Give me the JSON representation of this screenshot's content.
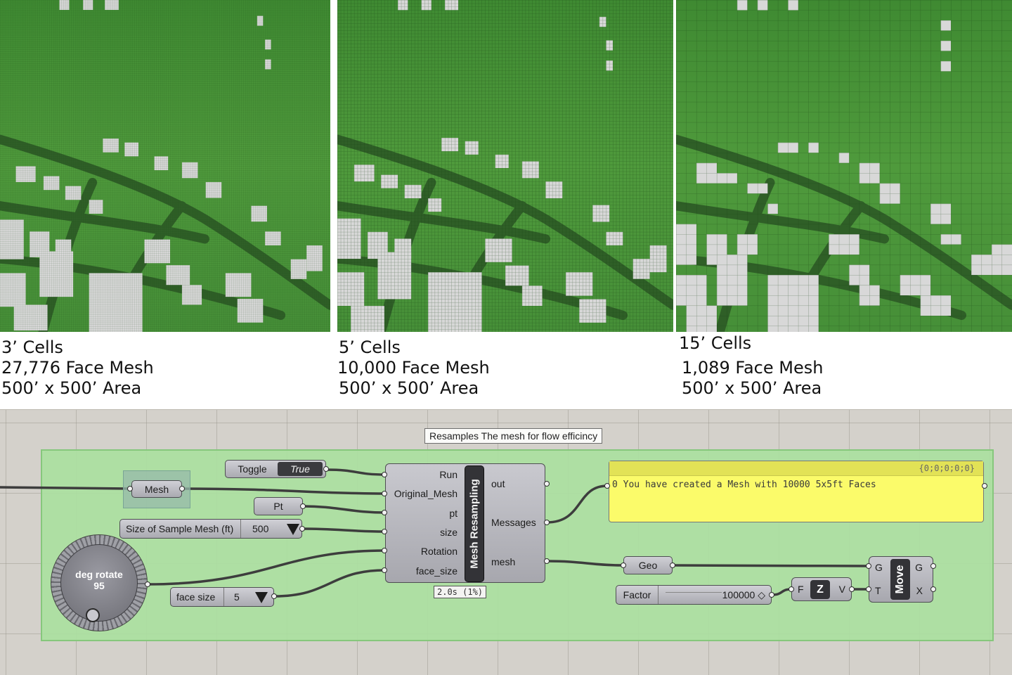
{
  "colors": {
    "mesh_green": "#4f9a3c",
    "road_green": "#2f5f27",
    "building_gray": "#d8d8d8",
    "group_green": "#aae0a0",
    "panel_yellow": "#fbfb6a",
    "canvas_gray": "#d4d1cb"
  },
  "panels": [
    {
      "line1": "3’ Cells",
      "line2": "27,776 Face Mesh",
      "line3": "500’ x 500’ Area",
      "cell_count_across": 167
    },
    {
      "line1": "5’ Cells",
      "line2": "10,000 Face Mesh",
      "line3": "500’ x 500’ Area",
      "cell_count_across": 100
    },
    {
      "line1": "15’ Cells",
      "line2": "1,089 Face Mesh",
      "line3": " 500’ x 500’ Area",
      "cell_count_across": 33
    }
  ],
  "grasshopper": {
    "group_title": "Resamples The mesh for flow efficincy",
    "toggle": {
      "label": "Toggle",
      "value": "True"
    },
    "mesh_param": {
      "label": "Mesh"
    },
    "pt_param": {
      "label": "Pt"
    },
    "size_slider": {
      "label": "Size of Sample Mesh (ft)",
      "value": "500"
    },
    "dial": {
      "label": "deg rotate",
      "value": "95"
    },
    "face_size_slider": {
      "label": "face size",
      "value": "5"
    },
    "resampler": {
      "name": "Mesh Resampling",
      "inputs": [
        "Run",
        "Original_Mesh",
        "pt",
        "size",
        "Rotation",
        "face_size"
      ],
      "outputs": [
        "out",
        "Messages",
        "mesh"
      ],
      "timing": "2.0s (1%)"
    },
    "panel": {
      "path": "{0;0;0;0;0}",
      "index": "0",
      "text": "You have created a Mesh with 10000 5x5ft Faces"
    },
    "geo_param": {
      "label": "Geo"
    },
    "factor_slider": {
      "label": "Factor",
      "value": "100000 ◇"
    },
    "unit_z": {
      "name": "Z",
      "in": "F",
      "out": "V"
    },
    "move": {
      "name": "Move",
      "in1": "G",
      "in2": "T",
      "out1": "G",
      "out2": "X"
    }
  }
}
